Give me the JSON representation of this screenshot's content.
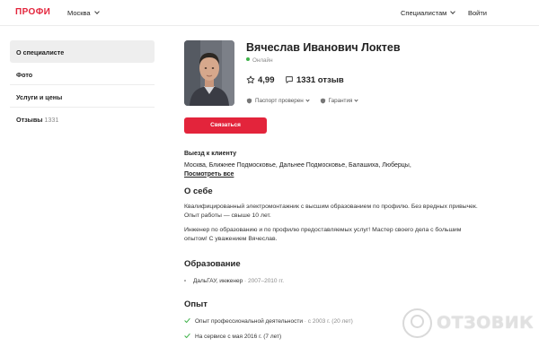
{
  "header": {
    "logo": "ПРОФИ",
    "city": "Москва",
    "specialists_menu": "Специалистам",
    "login": "Войти"
  },
  "sidebar": {
    "items": [
      {
        "label": "О специалисте",
        "active": true
      },
      {
        "label": "Фото"
      },
      {
        "label": "Услуги и цены"
      },
      {
        "label": "Отзывы",
        "count": "1331"
      }
    ]
  },
  "profile": {
    "name": "Вячеслав Иванович Локтев",
    "status": "Онлайн",
    "rating": "4,99",
    "reviews": "1331 отзыв",
    "badges": [
      "Паспорт проверен",
      "Гарантия"
    ],
    "contact_button": "Связаться"
  },
  "visit": {
    "title": "Выезд к клиенту",
    "areas": "Москва, Ближнее Подмосковье, Дальнее Подмосковье, Балашиха, Люберцы,",
    "see_all": "Посмотреть все"
  },
  "about": {
    "title": "О себе",
    "paragraph1": "Квалифицированный электромонтажник с высшим образованием по профилю. Без вредных привычек. Опыт работы — свыше 10 лет.",
    "paragraph2": "Инженер по образованию и по профилю предоставляемых услуг! Мастер своего дела с большим опытом! С уважением Вячеслав."
  },
  "education": {
    "title": "Образование",
    "items": [
      {
        "name": "ДальГАУ, инженер",
        "years": "2007–2010 гг."
      }
    ]
  },
  "experience": {
    "title": "Опыт",
    "items": [
      {
        "label": "Опыт профессиональной деятельности",
        "since": "с 2003 г. (20 лет)"
      },
      {
        "label": "На сервисе с мая 2016 г. (7 лет)",
        "since": ""
      }
    ]
  },
  "watermark": {
    "text": "ОТЗОВИК"
  },
  "colors": {
    "brand_red": "#e3243b",
    "online_green": "#3fb24a",
    "check_green": "#3fb24a"
  }
}
